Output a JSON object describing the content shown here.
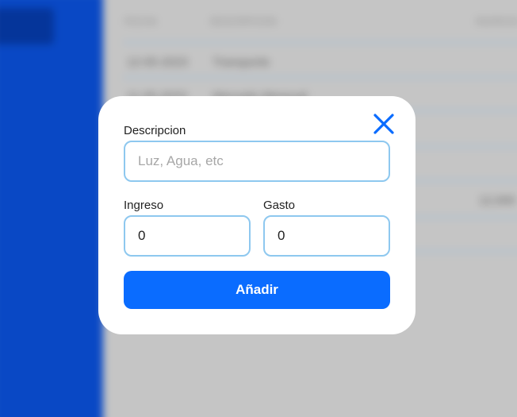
{
  "background": {
    "table_headers": [
      "FECHA",
      "DESCRIPCION",
      "INGRESO"
    ],
    "rows": [
      {
        "date": "12-05-2023",
        "description": "Transporte"
      },
      {
        "date": "11-05-2023",
        "description": "Mercado Mensual"
      }
    ],
    "total": "12,000"
  },
  "modal": {
    "close_icon": "close-icon",
    "description_label": "Descripcion",
    "description_placeholder": "Luz, Agua, etc",
    "income_label": "Ingreso",
    "income_value": "0",
    "expense_label": "Gasto",
    "expense_value": "0",
    "add_button_label": "Añadir"
  },
  "colors": {
    "accent": "#0a6cff",
    "close_icon": "#0a6cff",
    "input_border": "#8ec8ef",
    "sidebar": "#0a4fd6"
  }
}
